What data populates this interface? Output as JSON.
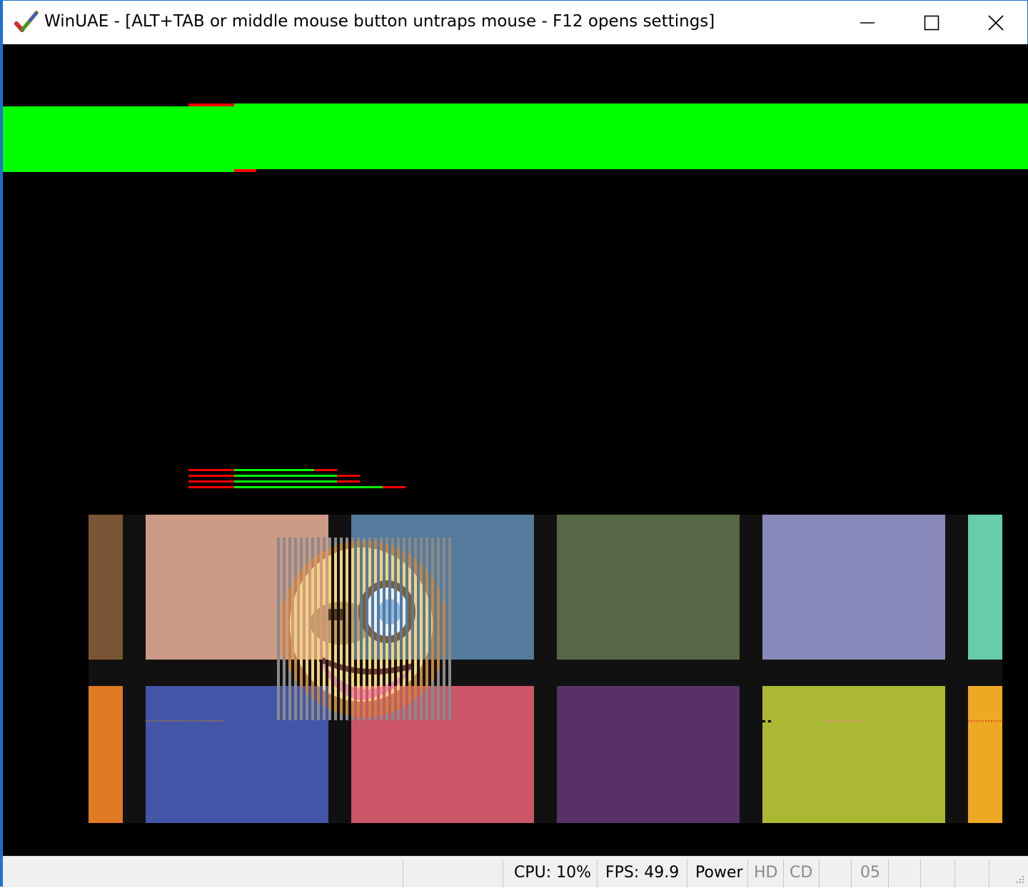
{
  "window": {
    "title": "WinUAE - [ALT+TAB or middle mouse button untraps mouse - F12 opens settings]",
    "controls": {
      "minimize": "minimize",
      "maximize": "maximize",
      "close": "close"
    }
  },
  "icons": {
    "app": "winuae-checkmark-icon",
    "minimize": "minimize-icon",
    "maximize": "maximize-icon",
    "close": "close-icon",
    "resize": "resize-grip-icon"
  },
  "colors": {
    "accent_border": "#1f6fd1",
    "green_bar": "#00ff00",
    "red_marker": "#ff0000",
    "tiles": [
      "#7a5535",
      "#cc9a87",
      "#557b9c",
      "#566746",
      "#8988bb",
      "#67cca9",
      "#e07a23",
      "#4555a8",
      "#cc5668",
      "#583166",
      "#abb833",
      "#eda923"
    ]
  },
  "statusbar": {
    "cpu": "CPU: 10%",
    "fps": "FPS: 49.9",
    "power": "Power",
    "hd": "HD",
    "cd": "CD",
    "drive": "05"
  }
}
